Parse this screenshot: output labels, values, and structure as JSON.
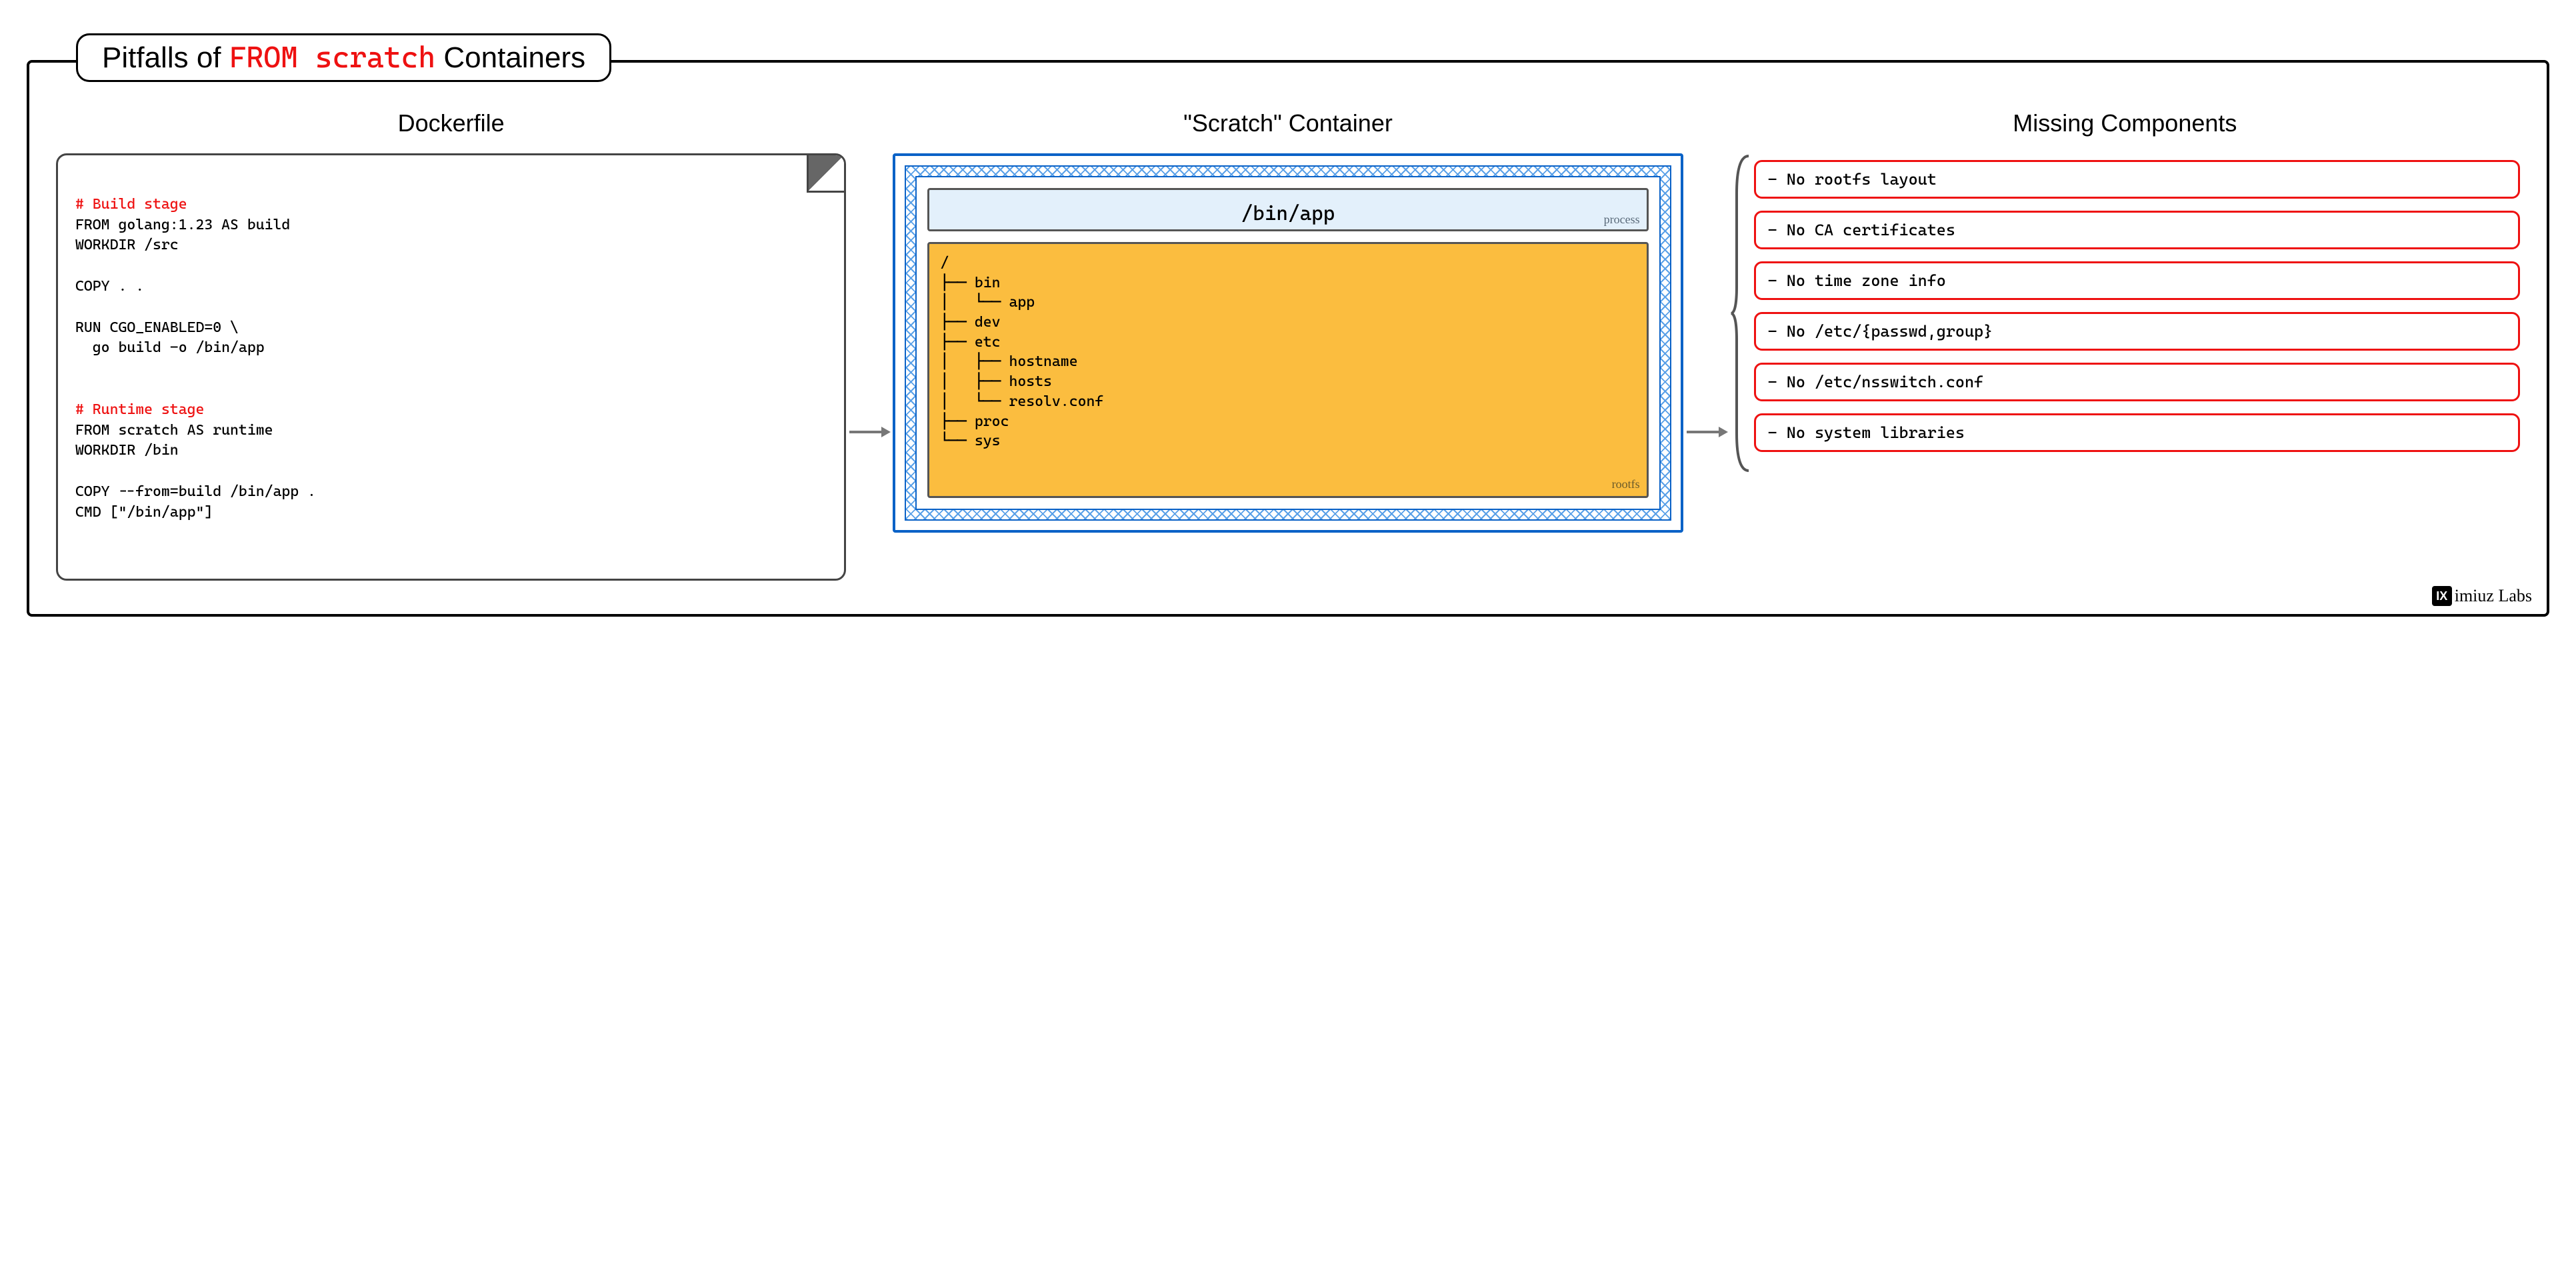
{
  "title": {
    "prefix": "Pitfalls of ",
    "highlight": "FROM scratch",
    "suffix": " Containers"
  },
  "columns": {
    "dockerfile": {
      "heading": "Dockerfile",
      "comment_build": "# Build stage",
      "lines_build": "FROM golang:1.23 AS build\nWORKDIR /src\n\nCOPY . .\n\nRUN CGO_ENABLED=0 \\\n  go build -o /bin/app",
      "comment_runtime": "# Runtime stage",
      "lines_runtime": "FROM scratch AS runtime\nWORKDIR /bin\n\nCOPY --from=build /bin/app .\nCMD [\"/bin/app\"]"
    },
    "container": {
      "heading": "\"Scratch\" Container",
      "process": {
        "label": "/bin/app",
        "tag": "process"
      },
      "rootfs": {
        "tree": "/\n├── bin\n│   └── app\n├── dev\n├── etc\n│   ├── hostname\n│   ├── hosts\n│   └── resolv.conf\n├── proc\n└── sys",
        "tag": "rootfs"
      }
    },
    "missing": {
      "heading": "Missing Components",
      "items": [
        "- No rootfs layout",
        "- No CA certificates",
        "- No time zone info",
        "- No /etc/{passwd,group}",
        "- No /etc/nsswitch.conf",
        "- No system libraries"
      ]
    }
  },
  "brand": {
    "logo_letter": "IX",
    "text": "imiuz Labs"
  }
}
